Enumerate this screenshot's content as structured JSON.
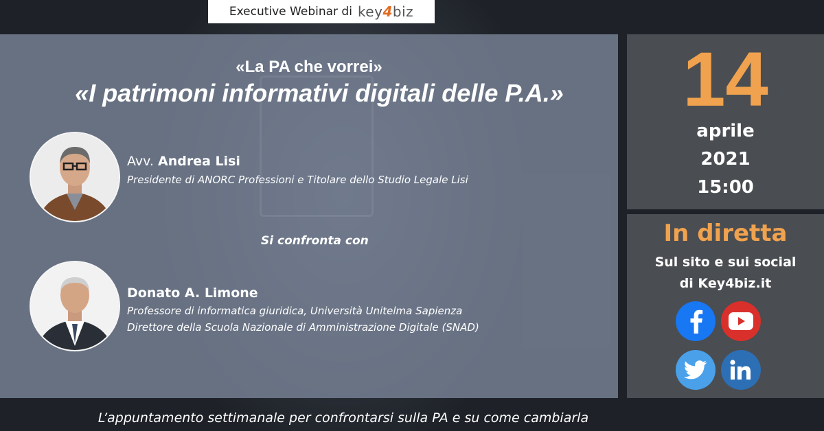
{
  "header": {
    "label": "Executive Webinar di",
    "brand_start": "key",
    "brand_mid": "4",
    "brand_end": "biz"
  },
  "event": {
    "series": "«La PA che vorrei»",
    "title": "«I patrimoni informativi digitali delle P.A.»"
  },
  "speakers": [
    {
      "prefix": "Avv. ",
      "name": "Andrea Lisi",
      "roles": [
        "Presidente di ANORC Professioni e Titolare dello Studio Legale Lisi"
      ]
    },
    {
      "prefix": "",
      "name": "Donato A. Limone",
      "roles": [
        "Professore di informatica giuridica, Università Unitelma Sapienza",
        "Direttore della Scuola Nazionale di Amministrazione Digitale (SNAD)"
      ]
    }
  ],
  "versus_text": "Si confronta con",
  "date": {
    "day": "14",
    "month": "aprile",
    "year": "2021",
    "time": "15:00"
  },
  "live": {
    "title": "In diretta",
    "line1": "Sul sito e sui social",
    "line2": "di Key4biz.it"
  },
  "social": {
    "facebook_color": "#1877f2",
    "youtube_color": "#d9302b",
    "twitter_color": "#4aa1ea",
    "linkedin_color": "#2c6fb4",
    "icons": [
      "facebook-icon",
      "youtube-icon",
      "twitter-icon",
      "linkedin-icon"
    ]
  },
  "colors": {
    "accent_orange": "#f0a24e",
    "panel": "#788396",
    "side_panel": "#4a4d52"
  },
  "footer": "L’appuntamento settimanale per confrontarsi sulla PA e su come cambiarla"
}
